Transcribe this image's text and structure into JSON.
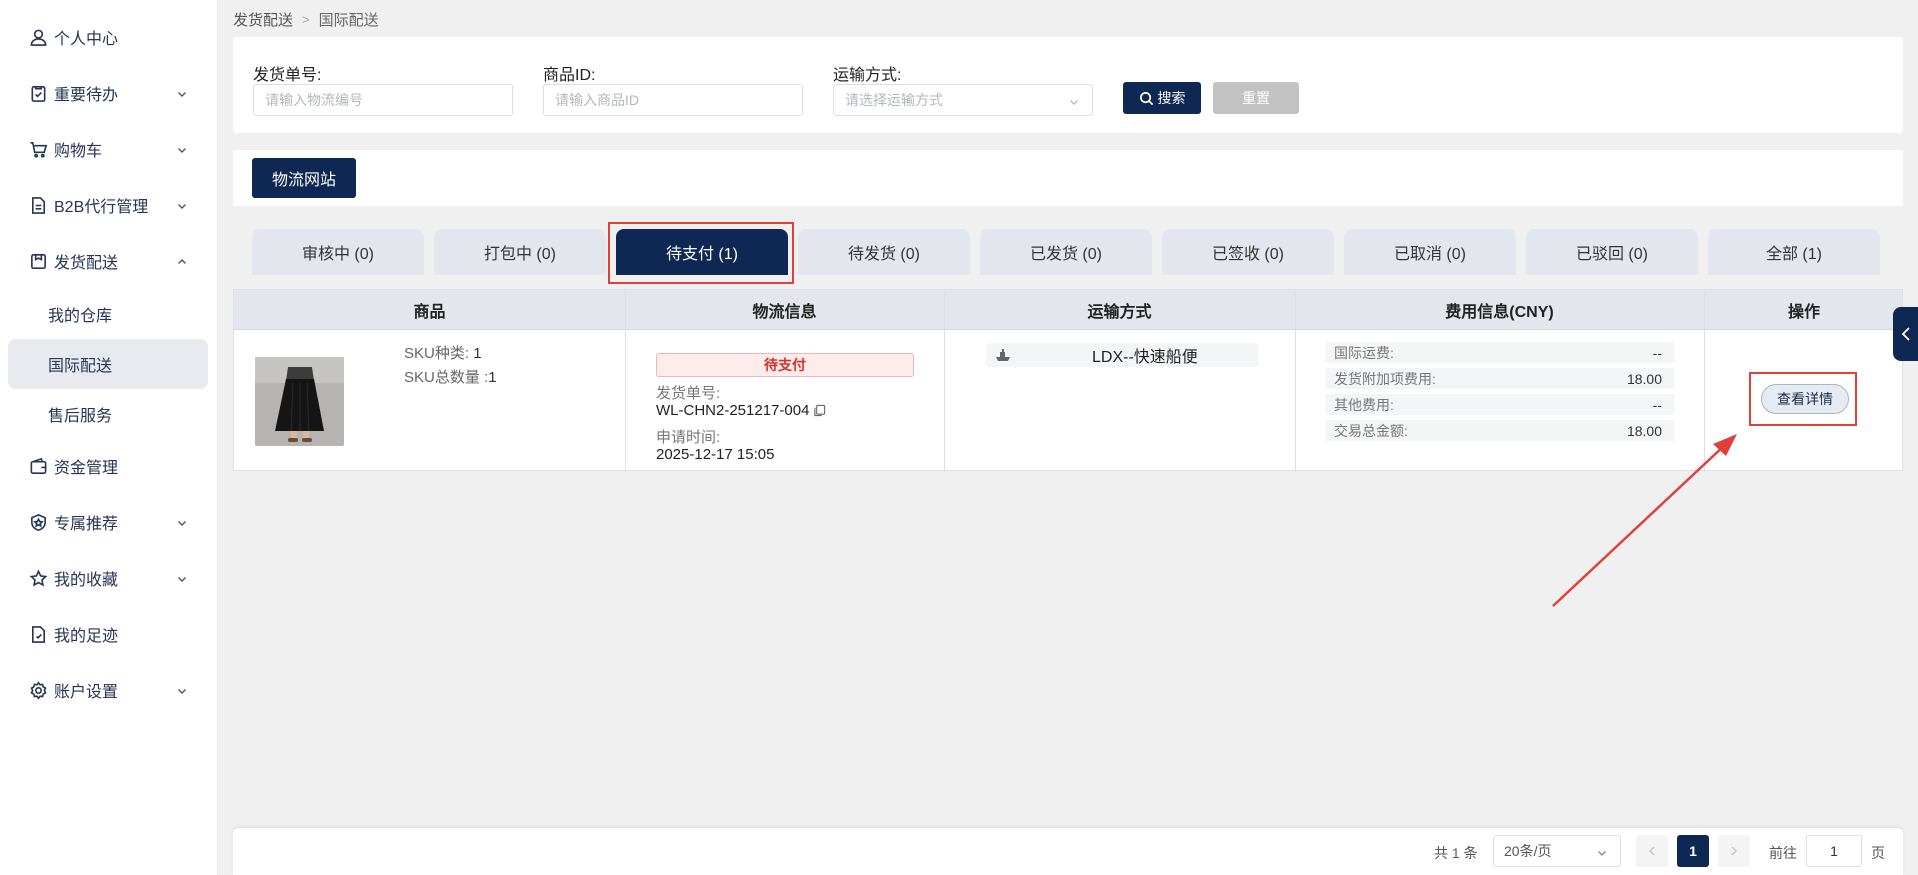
{
  "sidebar": {
    "items": [
      {
        "label": "个人中心",
        "icon": "user-icon",
        "has_arrow": false
      },
      {
        "label": "重要待办",
        "icon": "clipboard-check-icon",
        "has_arrow": true
      },
      {
        "label": "购物车",
        "icon": "cart-icon",
        "has_arrow": true
      },
      {
        "label": "B2B代行管理",
        "icon": "document-icon",
        "has_arrow": true
      },
      {
        "label": "发货配送",
        "icon": "box-icon",
        "has_arrow": true,
        "expanded": true
      },
      {
        "label": "资金管理",
        "icon": "wallet-icon",
        "has_arrow": false
      },
      {
        "label": "专属推荐",
        "icon": "star-shield-icon",
        "has_arrow": true
      },
      {
        "label": "我的收藏",
        "icon": "star-icon",
        "has_arrow": true
      },
      {
        "label": "我的足迹",
        "icon": "file-icon",
        "has_arrow": false
      },
      {
        "label": "账户设置",
        "icon": "gear-icon",
        "has_arrow": true
      }
    ],
    "sub_items": [
      {
        "label": "我的仓库",
        "active": false
      },
      {
        "label": "国际配送",
        "active": true
      },
      {
        "label": "售后服务",
        "active": false
      }
    ]
  },
  "breadcrumb": {
    "parent": "发货配送",
    "current": "国际配送"
  },
  "filters": {
    "shipment_no": {
      "label": "发货单号:",
      "placeholder": "请输入物流编号"
    },
    "product_id": {
      "label": "商品ID:",
      "placeholder": "请输入商品ID"
    },
    "shipping_method": {
      "label": "运输方式:",
      "placeholder": "请选择运输方式"
    },
    "search_label": "搜索",
    "reset_label": "重置"
  },
  "logistics_site_label": "物流网站",
  "tabs": [
    {
      "label": "审核中 (0)",
      "active": false
    },
    {
      "label": "打包中 (0)",
      "active": false
    },
    {
      "label": "待支付 (1)",
      "active": true
    },
    {
      "label": "待发货 (0)",
      "active": false
    },
    {
      "label": "已发货 (0)",
      "active": false
    },
    {
      "label": "已签收 (0)",
      "active": false
    },
    {
      "label": "已取消 (0)",
      "active": false
    },
    {
      "label": "已驳回 (0)",
      "active": false
    },
    {
      "label": "全部 (1)",
      "active": false
    }
  ],
  "table": {
    "headers": [
      "商品",
      "物流信息",
      "运输方式",
      "费用信息(CNY)",
      "操作"
    ],
    "row": {
      "sku_types_label": "SKU种类: ",
      "sku_types_value": "1",
      "sku_total_label": "SKU总数量 :",
      "sku_total_value": "1",
      "status": "待支付",
      "shipment_no_label": "发货单号:",
      "shipment_no": "WL-CHN2-251217-004",
      "apply_time_label": "申请时间:",
      "apply_time": "2025-12-17 15:05",
      "shipping_method": "LDX--快速船便",
      "fees": [
        {
          "label": "国际运费:",
          "value": "--"
        },
        {
          "label": "发货附加项费用:",
          "value": "18.00"
        },
        {
          "label": "其他费用:",
          "value": "--"
        },
        {
          "label": "交易总金额:",
          "value": "18.00"
        }
      ],
      "action_label": "查看详情"
    }
  },
  "pagination": {
    "total_text": "共 1 条",
    "page_size": "20条/页",
    "current_page": "1",
    "goto_label": "前往",
    "goto_value": "1",
    "unit": "页"
  },
  "colors": {
    "primary": "#0e2753",
    "highlight": "#e0403a",
    "status_red": "#d0342d"
  }
}
